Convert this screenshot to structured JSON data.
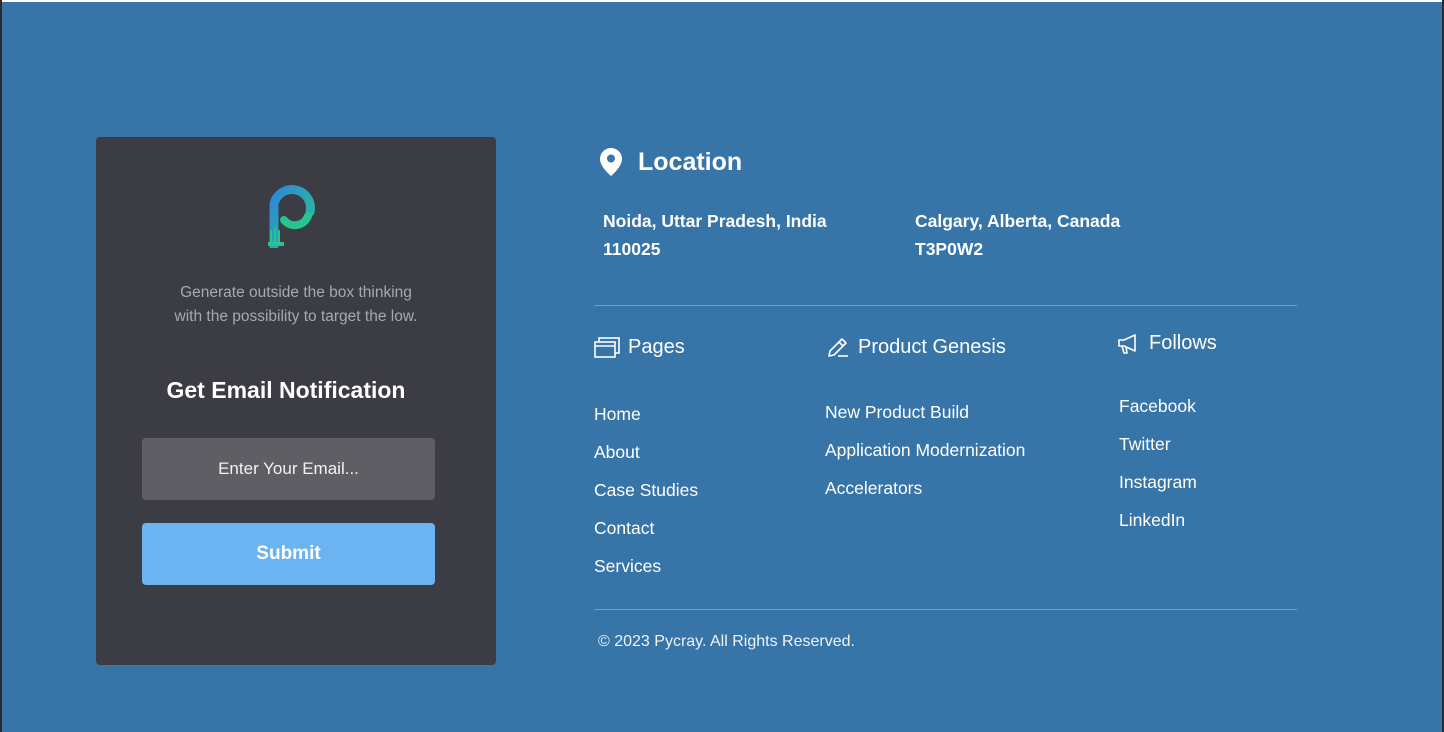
{
  "card": {
    "tagline_line1": "Generate outside the box thinking",
    "tagline_line2": "with the possibility to target the low.",
    "notify_title": "Get Email Notification",
    "email_placeholder": "Enter Your Email...",
    "submit_label": "Submit",
    "logo_icon": "pycray-p-logo-icon"
  },
  "location": {
    "title": "Location",
    "icon": "map-pin-icon",
    "addresses": [
      {
        "line1": "Noida, Uttar Pradesh, India",
        "line2": "110025"
      },
      {
        "line1": "Calgary, Alberta, Canada",
        "line2": "T3P0W2"
      }
    ]
  },
  "pages": {
    "title": "Pages",
    "icon": "windows-icon",
    "links": [
      "Home",
      "About",
      "Case Studies",
      "Contact",
      "Services"
    ]
  },
  "product": {
    "title": "Product Genesis",
    "icon": "pencil-icon",
    "links": [
      "New Product Build",
      "Application Modernization",
      "Accelerators"
    ]
  },
  "follows": {
    "title": "Follows",
    "icon": "megaphone-icon",
    "links": [
      "Facebook",
      "Twitter",
      "Instagram",
      "LinkedIn"
    ]
  },
  "copyright": "© 2023 Pycray. All Rights Reserved.",
  "colors": {
    "background": "#3774a8",
    "card": "#3b3c44",
    "input": "#5e5e64",
    "button": "#6cb3f1"
  }
}
